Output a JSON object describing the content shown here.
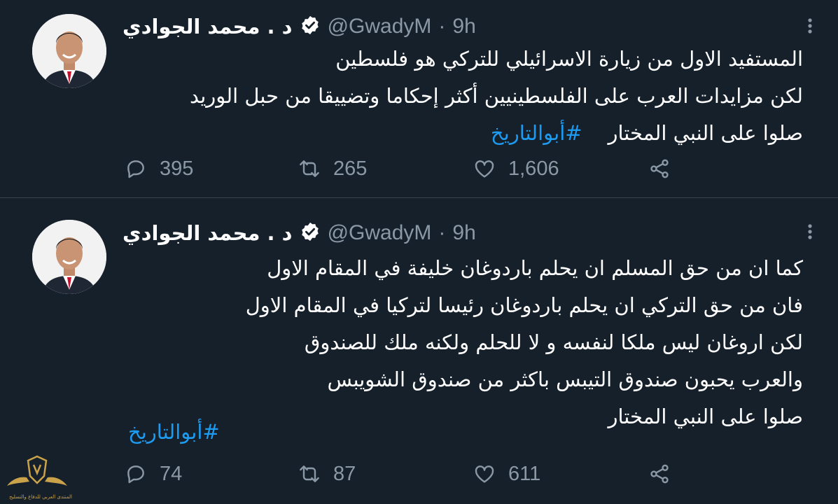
{
  "tweets": [
    {
      "author": {
        "display_name": "د . محمد الجوادي",
        "handle": "@GwadyM",
        "verified": true
      },
      "separator": "·",
      "time": "9h",
      "lines": [
        "المستفيد الاول من زيارة الاسرائيلي للتركي هو فلسطين",
        "لكن مزايدات العرب على الفلسطينيين أكثر إحكاما وتضييقا من حبل الوريد"
      ],
      "last_line": {
        "text": "صلوا على النبي المختار",
        "hashtag": "#أبوالتاريخ"
      },
      "stats": {
        "replies": "395",
        "retweets": "265",
        "likes": "1,606"
      },
      "icons": {
        "more": "more-vertical-icon",
        "reply": "reply-icon",
        "retweet": "retweet-icon",
        "like": "heart-icon",
        "share": "share-icon"
      }
    },
    {
      "author": {
        "display_name": "د . محمد الجوادي",
        "handle": "@GwadyM",
        "verified": true
      },
      "separator": "·",
      "time": "9h",
      "lines": [
        "كما ان من حق المسلم ان يحلم باردوغان خليفة في المقام الاول",
        " فان من حق التركي ان يحلم باردوغان رئيسا لتركيا في المقام الاول",
        "لكن اروغان ليس ملكا لنفسه و لا للحلم ولكنه ملك للصندوق",
        "والعرب يحبون صندوق التيبس باكثر من صندوق الشويبس",
        "صلوا على النبي المختار"
      ],
      "hashtag": "#أبوالتاريخ",
      "stats": {
        "replies": "74",
        "retweets": "87",
        "likes": "611"
      },
      "icons": {
        "more": "more-vertical-icon",
        "reply": "reply-icon",
        "retweet": "retweet-icon",
        "like": "heart-icon",
        "share": "share-icon"
      }
    }
  ],
  "watermark": {
    "text": "المنتدى العربي للدفاع والتسليح"
  },
  "colors": {
    "background": "#15202b",
    "text": "#ffffff",
    "secondary": "#8b98a5",
    "accent": "#1d9bf0",
    "divider": "#38444d"
  }
}
